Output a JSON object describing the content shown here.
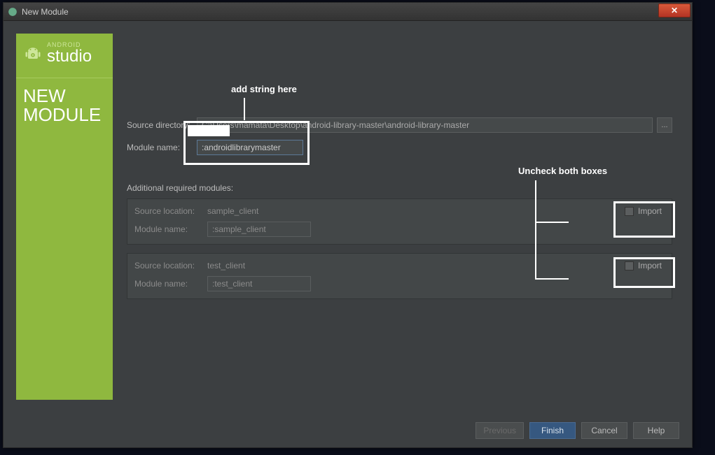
{
  "window": {
    "title": "New Module"
  },
  "sidebar": {
    "brand_top": "ANDROID",
    "brand_main": "studio",
    "heading_line1": "NEW",
    "heading_line2": "MODULE"
  },
  "annotations": {
    "add_string": "add string here",
    "uncheck_boxes": "Uncheck both boxes"
  },
  "form": {
    "source_dir_label": "Source directory:",
    "source_dir_value": "C:\\Users\\mamata\\Desktop\\android-library-master\\android-library-master",
    "module_name_label": "Module name:",
    "module_name_value": ":androidlibrarymaster",
    "browse_symbol": "...",
    "additional_header": "Additional required modules:"
  },
  "modules": [
    {
      "src_label": "Source location:",
      "src_value": "sample_client",
      "name_label": "Module name:",
      "name_value": ":sample_client",
      "import_label": "Import"
    },
    {
      "src_label": "Source location:",
      "src_value": "test_client",
      "name_label": "Module name:",
      "name_value": ":test_client",
      "import_label": "Import"
    }
  ],
  "buttons": {
    "previous": "Previous",
    "finish": "Finish",
    "cancel": "Cancel",
    "help": "Help"
  },
  "colors": {
    "sidebar_green": "#8fb83f",
    "dialog_bg": "#3c3f41",
    "primary_btn": "#365880",
    "close_red": "#c94c35"
  }
}
